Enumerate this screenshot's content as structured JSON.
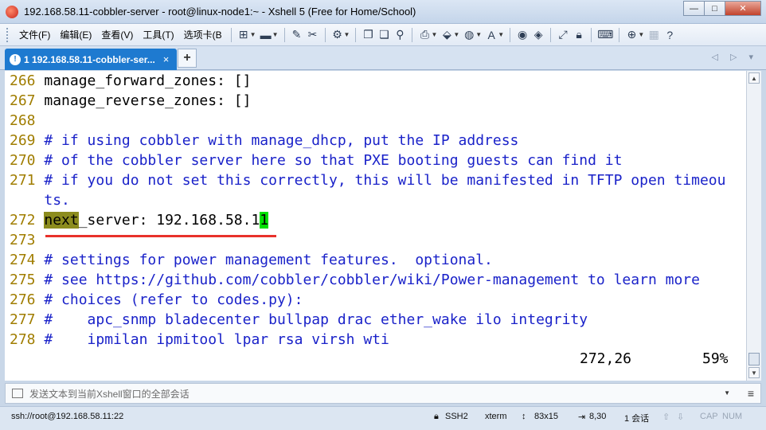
{
  "window": {
    "title": "192.168.58.11-cobbler-server - root@linux-node1:~ - Xshell 5 (Free for Home/School)",
    "buttons": {
      "minimize": "—",
      "maximize": "□",
      "close": "✕"
    }
  },
  "menu": {
    "items": [
      "文件(F)",
      "编辑(E)",
      "查看(V)",
      "工具(T)",
      "选项卡(B"
    ]
  },
  "tab": {
    "status": "!",
    "label": "1 192.168.58.11-cobbler-ser...",
    "close": "×",
    "add": "+",
    "nav": "◁ ▷ ▾"
  },
  "terminal": {
    "lines": [
      {
        "num": "266",
        "code": "manage_forward_zones: []"
      },
      {
        "num": "267",
        "code": "manage_reverse_zones: []"
      },
      {
        "num": "268",
        "code": ""
      },
      {
        "num": "269",
        "comment": "# if using cobbler with manage_dhcp, put the IP address"
      },
      {
        "num": "270",
        "comment": "# of the cobbler server here so that PXE booting guests can find it"
      },
      {
        "num": "271",
        "comment": "# if you do not set this correctly, this will be manifested in TFTP open timeou"
      },
      {
        "num": "",
        "comment": "ts."
      },
      {
        "num": "272",
        "highlight": "next",
        "code": "_server: 192.168.58.1",
        "cursor": "1"
      },
      {
        "num": "273",
        "code": ""
      },
      {
        "num": "274",
        "comment": "# settings for power management features.  optional."
      },
      {
        "num": "275",
        "comment": "# see https://github.com/cobbler/cobbler/wiki/Power-management to learn more"
      },
      {
        "num": "276",
        "comment": "# choices (refer to codes.py):"
      },
      {
        "num": "277",
        "comment": "#    apc_snmp bladecenter bullpap drac ether_wake ilo integrity"
      },
      {
        "num": "278",
        "comment": "#    ipmilan ipmitool lpar rsa virsh wti"
      }
    ],
    "cursor_position": "272,26",
    "scroll_percent": "59%"
  },
  "compose": {
    "placeholder": "发送文本到当前Xshell窗口的全部会话"
  },
  "statusbar": {
    "connection": "ssh://root@192.168.58.11:22",
    "protocol": "SSH2",
    "terminal_type": "xterm",
    "size": "83x15",
    "cursor": "8,30",
    "sessions": "1 会话",
    "caps": "CAP",
    "num": "NUM"
  },
  "colors": {
    "line_number": "#a07d00",
    "comment": "#1a22c9",
    "search_highlight": "#8c8c1e",
    "cursor": "#00e000",
    "annotation_underline": "#e8312b",
    "tab_active": "#1e7ad0"
  }
}
